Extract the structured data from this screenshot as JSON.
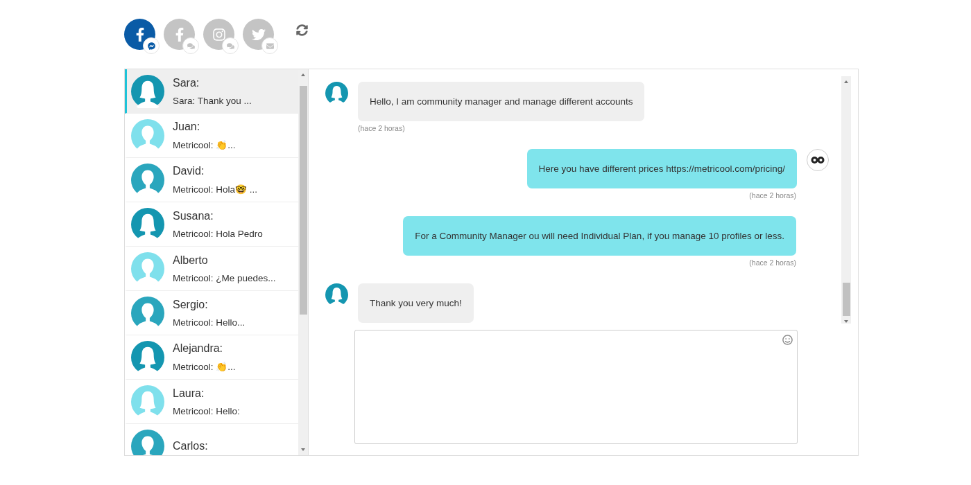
{
  "accounts": [
    {
      "kind": "facebook",
      "badge": {
        "kind": "messenger"
      },
      "selected": true
    },
    {
      "kind": "facebook",
      "badge": {
        "kind": "comments"
      },
      "selected": false
    },
    {
      "kind": "instagram",
      "badge": {
        "kind": "comments"
      },
      "selected": false
    },
    {
      "kind": "twitter",
      "badge": {
        "kind": "mail"
      },
      "selected": false
    }
  ],
  "conversations": [
    {
      "name": "Sara:",
      "preview": "Sara: Thank you ...",
      "kind": "female",
      "color": "#1496b0",
      "selected": true
    },
    {
      "name": "Juan:",
      "preview": "Metricool: 👏...",
      "kind": "male",
      "color": "#7fe0ec",
      "selected": false
    },
    {
      "name": "David:",
      "preview": "Metricool: Hola🤓 ...",
      "kind": "male",
      "color": "#2aa6bd",
      "selected": false
    },
    {
      "name": "Susana:",
      "preview": "Metricool: Hola Pedro",
      "kind": "female",
      "color": "#1496b0",
      "selected": false
    },
    {
      "name": "Alberto",
      "preview": "Metricool: ¿Me puedes...",
      "kind": "male",
      "color": "#7fe0ec",
      "selected": false
    },
    {
      "name": "Sergio:",
      "preview": "Metricool: Hello...",
      "kind": "male",
      "color": "#2aa6bd",
      "selected": false
    },
    {
      "name": "Alejandra:",
      "preview": "Metricool: 👏...",
      "kind": "female",
      "color": "#1496b0",
      "selected": false
    },
    {
      "name": "Laura:",
      "preview": "Metricool: Hello:",
      "kind": "female",
      "color": "#7fe0ec",
      "selected": false
    },
    {
      "name": "Carlos:",
      "kind": "male",
      "color": "#2aa6bd",
      "selected": false
    }
  ],
  "messages": [
    {
      "kind": "incoming",
      "text": "Hello, I am community manager and manage different accounts",
      "time": "(hace 2 horas)",
      "avatar": true
    },
    {
      "kind": "outgoing",
      "text": "Here you have different prices https://metricool.com/pricing/",
      "time": "(hace 2 horas)",
      "avatar": true
    },
    {
      "kind": "outgoing",
      "text": "For a Community Manager ou will need Individual Plan, if you manage 10 profiles or less.",
      "time": "(hace 2 horas)",
      "avatar": false
    },
    {
      "kind": "incoming",
      "text": "Thank you very much!",
      "avatar": true
    }
  ]
}
